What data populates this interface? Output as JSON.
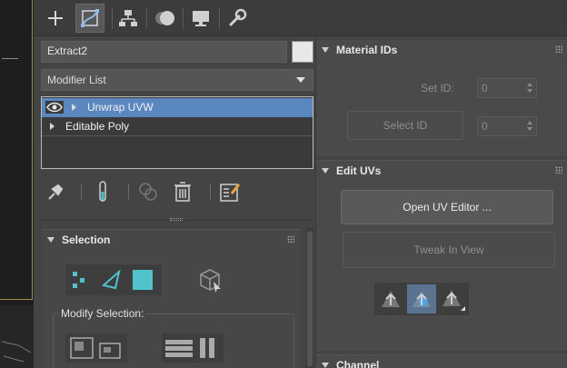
{
  "object_name": "Extract2",
  "modifier_list_label": "Modifier List",
  "modifier_stack": [
    {
      "label": "Unwrap UVW",
      "selected": true
    },
    {
      "label": "Editable Poly",
      "selected": false
    }
  ],
  "tabs": [
    "create-tab",
    "modify-tab",
    "hierarchy-tab",
    "motion-tab",
    "display-tab",
    "utilities-tab"
  ],
  "selection_rollout": {
    "title": "Selection",
    "modify_selection_label": "Modify Selection:"
  },
  "material_ids_rollout": {
    "title": "Material IDs",
    "set_id_label": "Set ID:",
    "set_id_value": "0",
    "select_id_label": "Select ID",
    "select_id_value": "0"
  },
  "edit_uvs_rollout": {
    "title": "Edit UVs",
    "open_uv_editor_label": "Open UV Editor ...",
    "tweak_in_view_label": "Tweak In View"
  },
  "channel_rollout": {
    "title": "Channel"
  },
  "colors": {
    "panel_bg": "#444444",
    "selected_row": "#5b87c0",
    "highlight_cyan": "#4fc3c9",
    "viewport_border": "#a08c4c"
  }
}
